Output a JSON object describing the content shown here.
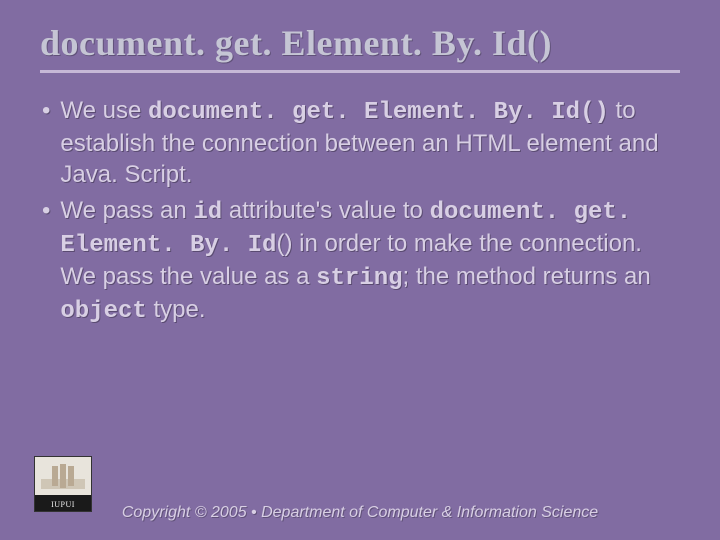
{
  "title": "document. get. Element. By. Id()",
  "bullets": [
    {
      "pre": "We use ",
      "code1": "document. get. Element. By. Id()",
      "post1": " to establish the connection between an HTML element and Java. Script."
    },
    {
      "pre": "We pass an ",
      "code1": "id",
      "mid1": " attribute's value to ",
      "code2": "document. get. Element. By. Id",
      "mid2": "() in order to make the connection. We pass the value as a ",
      "code3": "string",
      "mid3": "; the method returns an ",
      "code4": "object",
      "post": " type."
    }
  ],
  "footer": "Copyright © 2005 • Department of Computer & Information Science",
  "logo_label": "IUPUI"
}
